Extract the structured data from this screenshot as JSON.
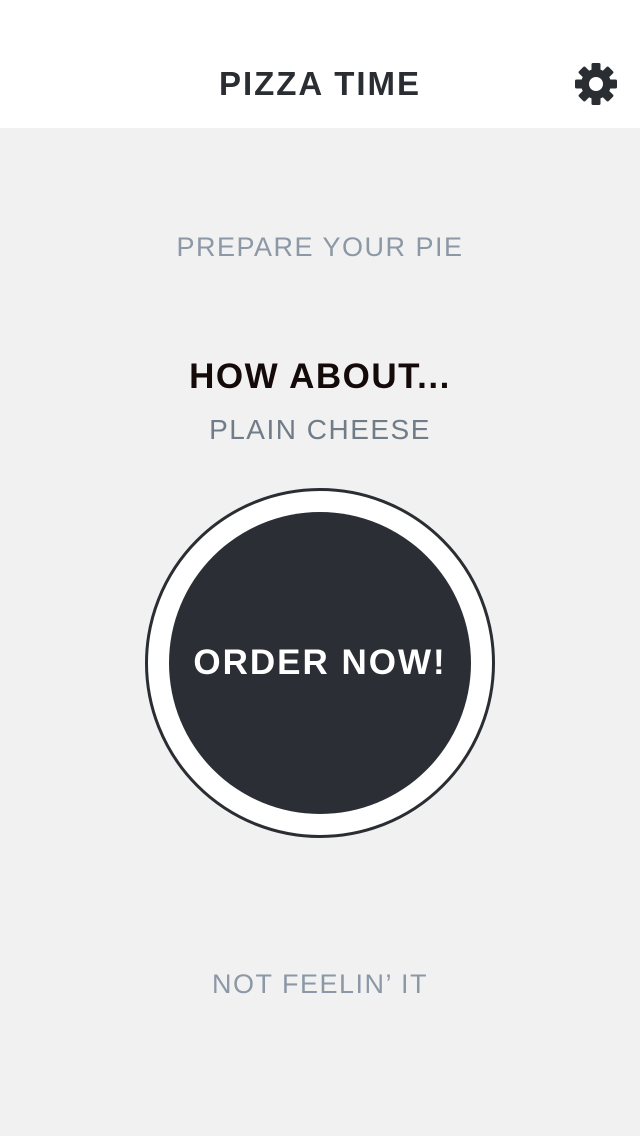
{
  "header": {
    "title": "PIZZA TIME",
    "settings_icon": "gear-icon"
  },
  "main": {
    "section_label": "PREPARE YOUR PIE",
    "prompt": "HOW ABOUT...",
    "suggestion": "PLAIN CHEESE",
    "order_button_label": "ORDER NOW!",
    "dismiss_label": "NOT FEELIN’ IT"
  },
  "colors": {
    "background": "#f1f1f1",
    "header_background": "#ffffff",
    "primary_dark": "#2b2f35",
    "muted_text": "#8c98a6",
    "button_text": "#ffffff"
  }
}
